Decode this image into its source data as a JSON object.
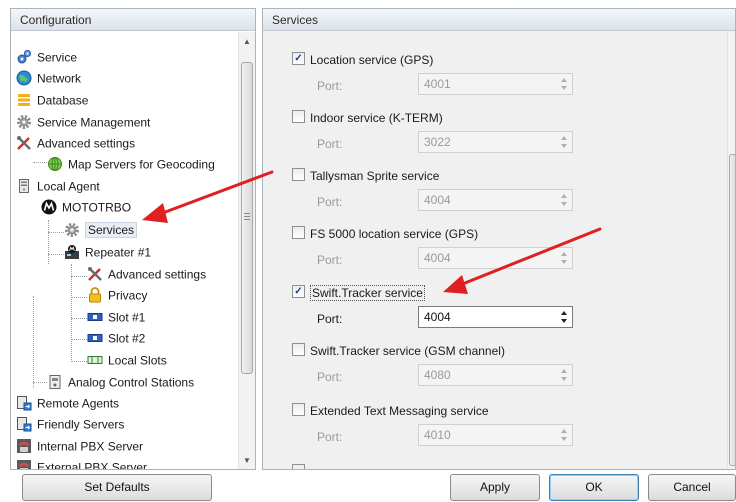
{
  "left_panel": {
    "title": "Configuration",
    "tree": [
      {
        "label": "Service",
        "icon": "service-gears-icon"
      },
      {
        "label": "Network",
        "icon": "network-globe-icon"
      },
      {
        "label": "Database",
        "icon": "database-icon"
      },
      {
        "label": "Service Management",
        "icon": "gear-icon"
      },
      {
        "label": "Advanced settings",
        "icon": "tools-icon"
      },
      {
        "label": "Map Servers for Geocoding",
        "icon": "globe-plus-icon"
      },
      {
        "label": "Local Agent",
        "icon": "local-agent-icon"
      },
      {
        "label": "MOTOTRBO",
        "icon": "motorola-logo-icon"
      },
      {
        "label": "Services",
        "icon": "gear-icon",
        "selected": true
      },
      {
        "label": "Repeater #1",
        "icon": "repeater-icon"
      },
      {
        "label": "Advanced settings",
        "icon": "tools-icon"
      },
      {
        "label": "Privacy",
        "icon": "lock-icon"
      },
      {
        "label": "Slot #1",
        "icon": "slot-icon"
      },
      {
        "label": "Slot #2",
        "icon": "slot-icon"
      },
      {
        "label": "Local Slots",
        "icon": "local-slots-icon"
      },
      {
        "label": "Analog Control Stations",
        "icon": "analog-station-icon"
      },
      {
        "label": "Remote Agents",
        "icon": "remote-agents-icon"
      },
      {
        "label": "Friendly Servers",
        "icon": "friendly-servers-icon"
      },
      {
        "label": "Internal PBX Server",
        "icon": "pbx-phone-icon"
      },
      {
        "label": "External PBX Server",
        "icon": "pbx-phone-icon"
      }
    ]
  },
  "right_panel": {
    "title": "Services",
    "port_label": "Port:",
    "services": [
      {
        "label": "Location service (GPS)",
        "checked": true,
        "port": "4001"
      },
      {
        "label": "Indoor service (K-TERM)",
        "checked": false,
        "port": "3022"
      },
      {
        "label": "Tallysman Sprite service",
        "checked": false,
        "port": "4004"
      },
      {
        "label": "FS 5000 location service (GPS)",
        "checked": false,
        "port": "4004"
      },
      {
        "label": "Swift.Tracker service",
        "checked": true,
        "port": "4004",
        "enabled": true
      },
      {
        "label": "Swift.Tracker service (GSM channel)",
        "checked": false,
        "port": "4080"
      },
      {
        "label": "Extended Text Messaging service",
        "checked": false,
        "port": "4010"
      }
    ]
  },
  "buttons": {
    "set_defaults": "Set Defaults",
    "apply": "Apply",
    "ok": "OK",
    "cancel": "Cancel"
  },
  "colors": {
    "annotation_arrow": "#e02020",
    "panel_border": "#a9b2bd",
    "checkmark": "#1a3d8f"
  }
}
